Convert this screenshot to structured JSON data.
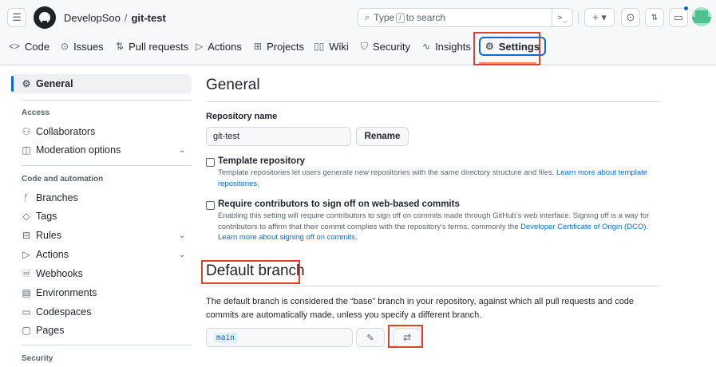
{
  "header": {
    "owner": "DevelopSoo",
    "separator": "/",
    "repo": "git-test",
    "search": {
      "prefix": "Type",
      "slash": "/",
      "suffix": "to search",
      "cmd_icon": ">_"
    },
    "plus_label": "+ ▾",
    "icons": [
      "hamburger-icon",
      "github-logo",
      "command-palette-icon",
      "plus-icon",
      "issue-opened-icon",
      "git-pull-request-icon",
      "inbox-icon",
      "avatar"
    ]
  },
  "tabs": [
    {
      "label": "Code",
      "icon": "<>"
    },
    {
      "label": "Issues",
      "icon": "⊙"
    },
    {
      "label": "Pull requests",
      "icon": "⇅"
    },
    {
      "label": "Actions",
      "icon": "▷"
    },
    {
      "label": "Projects",
      "icon": "⊞"
    },
    {
      "label": "Wiki",
      "icon": "▯▯"
    },
    {
      "label": "Security",
      "icon": "⛉"
    },
    {
      "label": "Insights",
      "icon": "∿"
    },
    {
      "label": "Settings",
      "icon": "⚙"
    }
  ],
  "sidebar": {
    "general": "General",
    "access_heading": "Access",
    "collaborators": "Collaborators",
    "moderation": "Moderation options",
    "code_heading": "Code and automation",
    "branches": "Branches",
    "tags": "Tags",
    "rules": "Rules",
    "actions": "Actions",
    "webhooks": "Webhooks",
    "environments": "Environments",
    "codespaces": "Codespaces",
    "pages": "Pages",
    "security_heading": "Security"
  },
  "main": {
    "title": "General",
    "repo_name_label": "Repository name",
    "repo_name_value": "git-test",
    "rename_label": "Rename",
    "template": {
      "title": "Template repository",
      "desc": "Template repositories let users generate new repositories with the same directory structure and files.",
      "link": "Learn more about template repositories."
    },
    "signoff": {
      "title": "Require contributors to sign off on web-based commits",
      "desc": "Enabling this setting will require contributors to sign off on commits made through GitHub’s web interface. Signing off is a way for contributors to affirm that their commit complies with the repository's terms, commonly the",
      "link1": "Developer Certificate of Origin (DCO).",
      "link2": "Learn more about signing off on commits."
    },
    "default_branch": {
      "title": "Default branch",
      "desc": "The default branch is considered the “base” branch in your repository, against which all pull requests and code commits are automatically made, unless you specify a different branch.",
      "branch": "main"
    }
  },
  "colors": {
    "accent": "#0969da",
    "highlight": "#e3402c",
    "tab_underline": "#fd8c73"
  }
}
